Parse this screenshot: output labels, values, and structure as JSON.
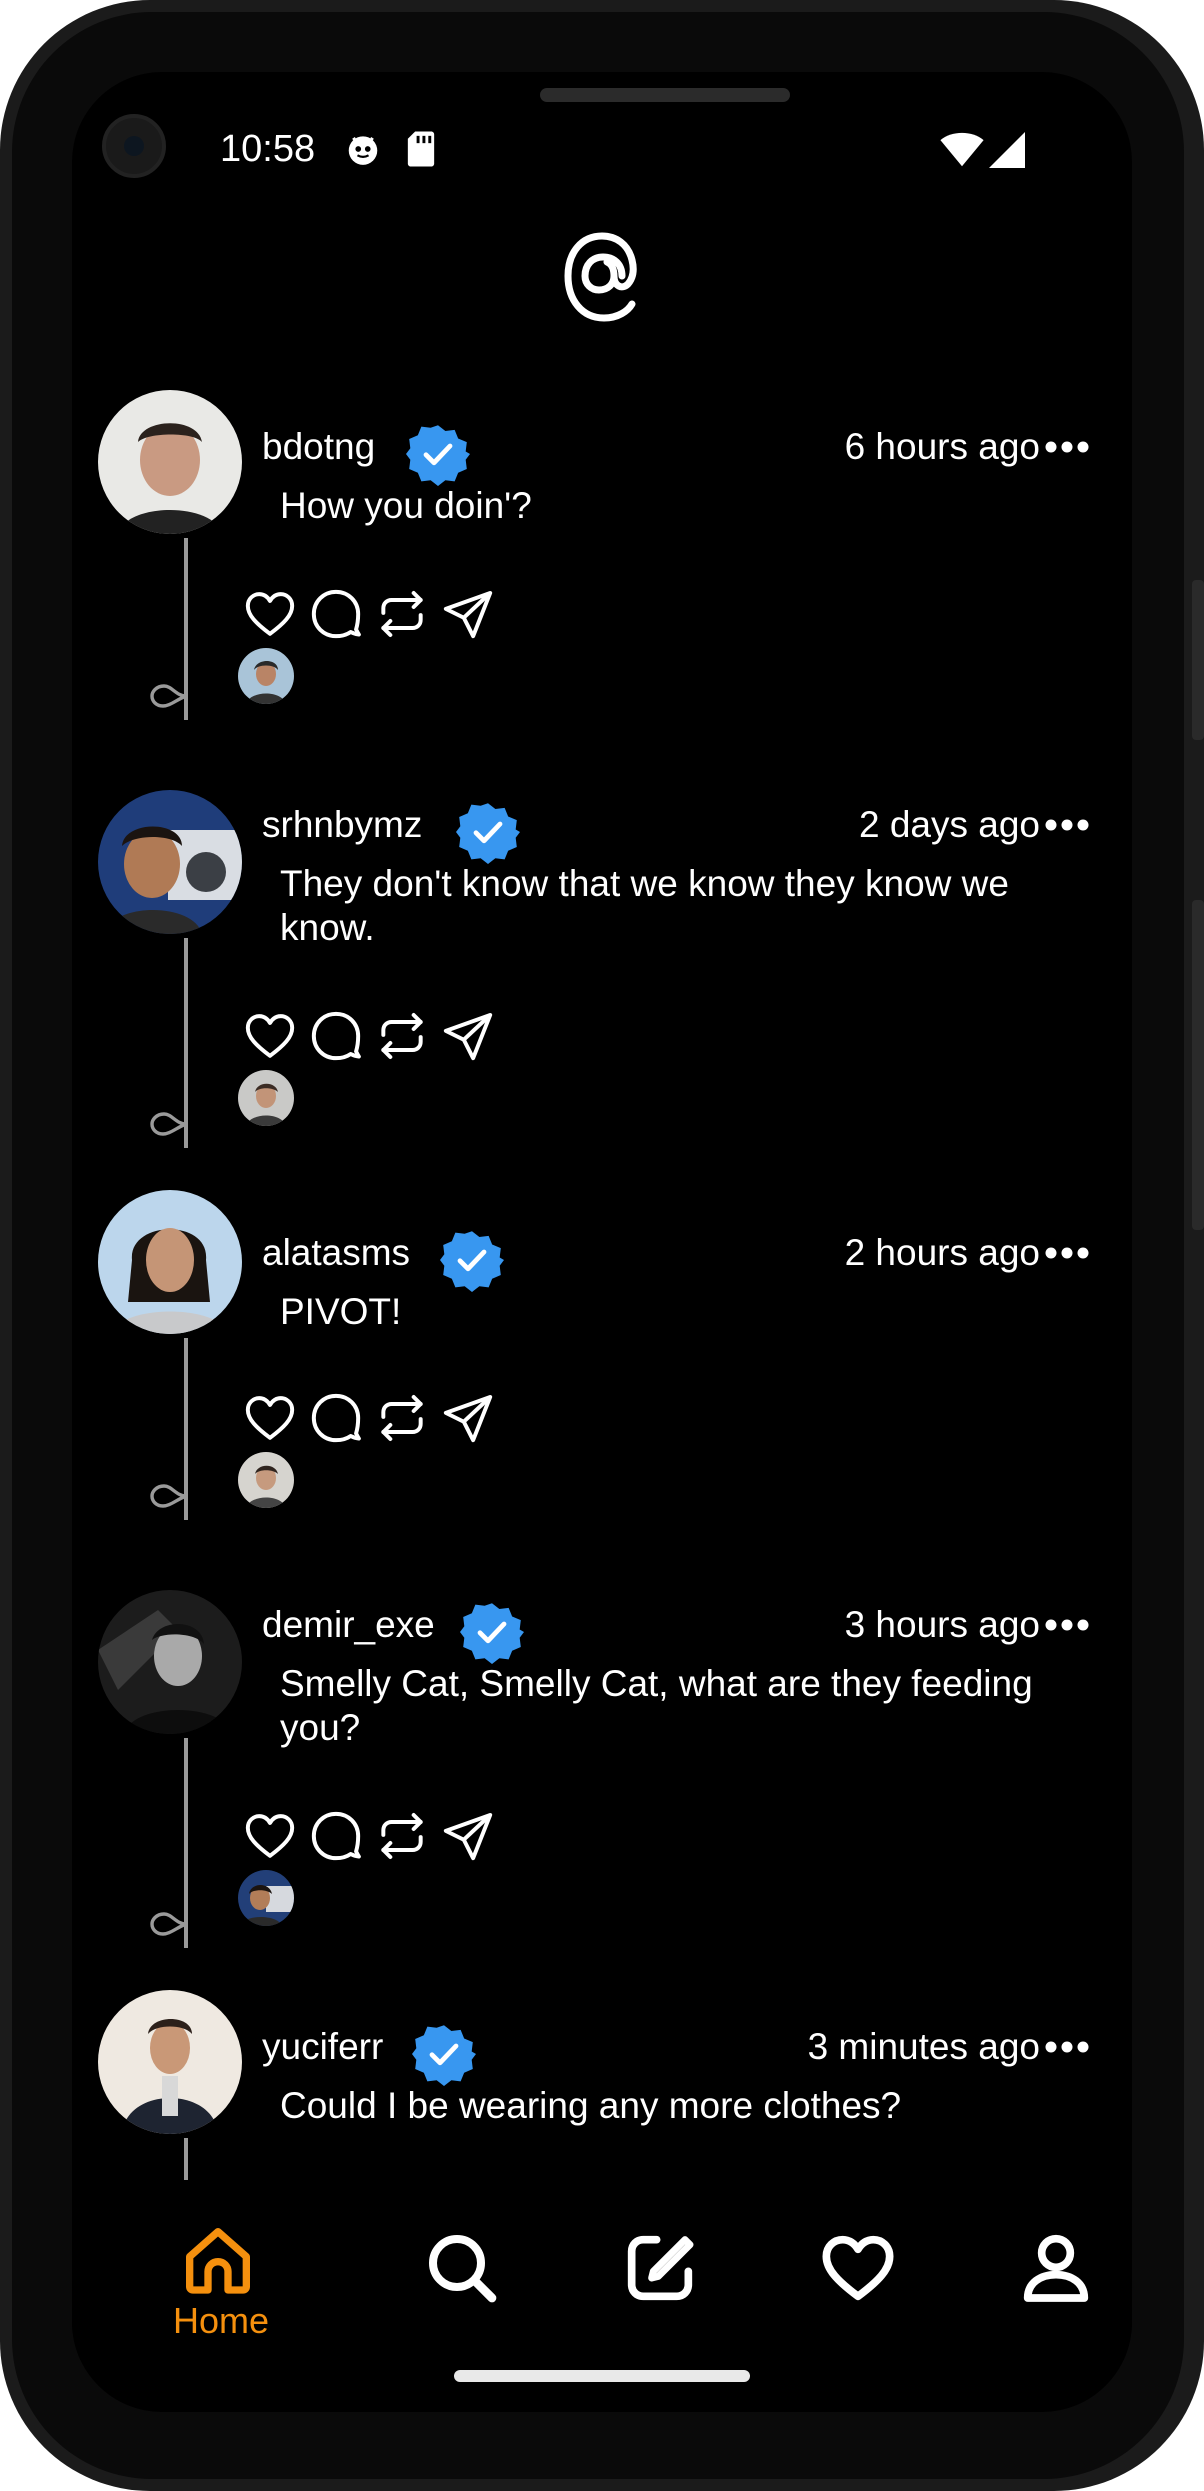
{
  "status_bar": {
    "time": "10:58"
  },
  "theme": {
    "background": "#000000",
    "text": "#ffffff",
    "accent": "#f5900e",
    "verified": "#3897f0",
    "thread_line": "#9a9a9a"
  },
  "posts": [
    {
      "username": "bdotng",
      "verified": true,
      "time": "6 hours ago",
      "text": "How you doin'?"
    },
    {
      "username": "srhnbymz",
      "verified": true,
      "time": "2 days ago",
      "text": "They don't know that we know they know we know."
    },
    {
      "username": "alatasms",
      "verified": true,
      "time": "2 hours ago",
      "text": "PIVOT!"
    },
    {
      "username": "demir_exe",
      "verified": true,
      "time": "3 hours ago",
      "text": "Smelly Cat, Smelly Cat, what are they feeding you?"
    },
    {
      "username": "yuciferr",
      "verified": true,
      "time": "3 minutes ago",
      "text": "Could I be wearing any more clothes?"
    }
  ],
  "post_actions": [
    "heart-icon",
    "comment-icon",
    "repost-icon",
    "share-icon"
  ],
  "tabbar": {
    "active": "home",
    "items": [
      {
        "icon": "home-icon",
        "label": "Home"
      },
      {
        "icon": "search-icon",
        "label": ""
      },
      {
        "icon": "compose-icon",
        "label": ""
      },
      {
        "icon": "heart-icon",
        "label": ""
      },
      {
        "icon": "profile-icon",
        "label": ""
      }
    ]
  }
}
